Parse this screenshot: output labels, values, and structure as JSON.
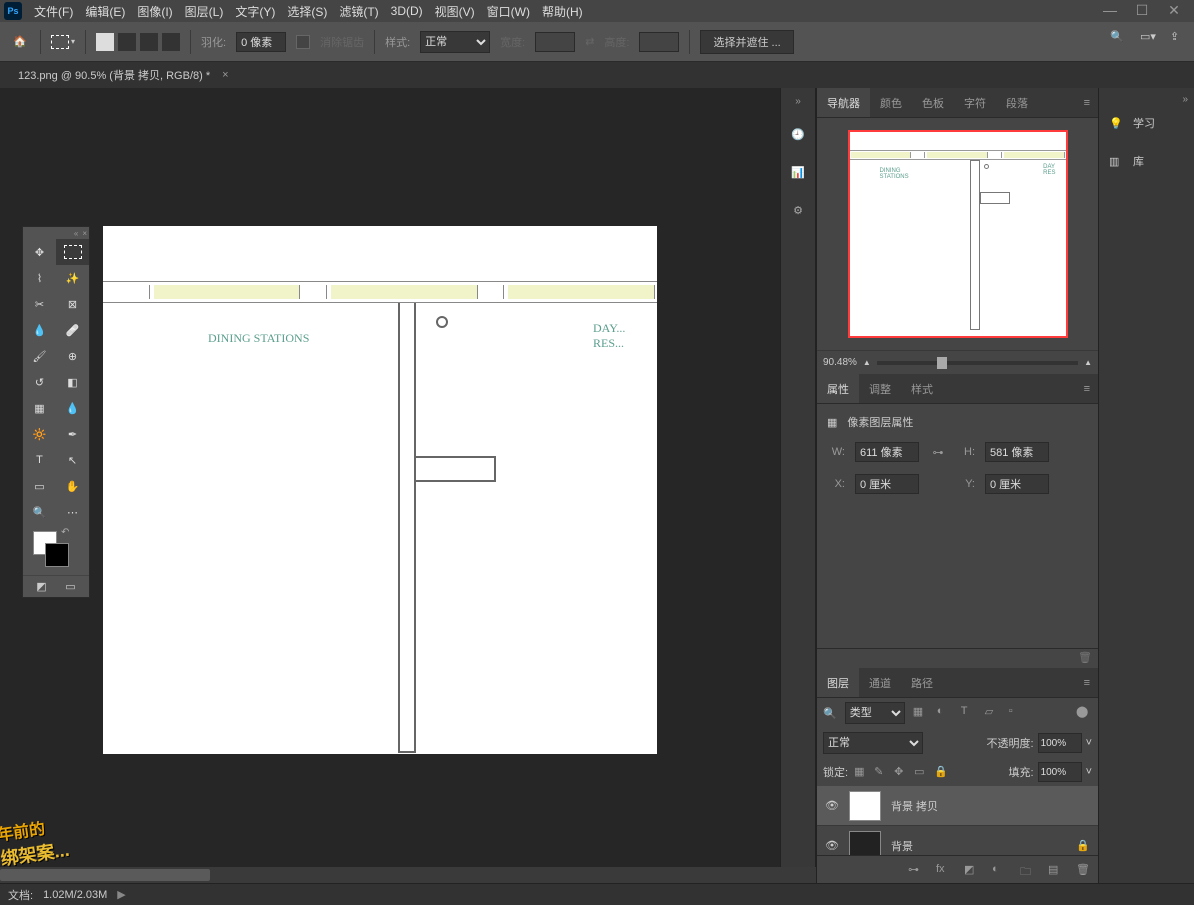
{
  "app_icon": "Ps",
  "menu": {
    "file": "文件(F)",
    "edit": "编辑(E)",
    "image": "图像(I)",
    "layer": "图层(L)",
    "type": "文字(Y)",
    "select": "选择(S)",
    "filter": "滤镜(T)",
    "threed": "3D(D)",
    "view": "视图(V)",
    "window": "窗口(W)",
    "help": "帮助(H)"
  },
  "options": {
    "feather_label": "羽化:",
    "feather_value": "0 像素",
    "antialias": "消除锯齿",
    "style_label": "样式:",
    "style_value": "正常",
    "width_label": "宽度:",
    "height_label": "高度:",
    "mask_btn": "选择并遮住 ..."
  },
  "tab": {
    "title": "123.png @ 90.5% (背景 拷贝, RGB/8) *"
  },
  "canvas": {
    "label1": "DINING\nSTATIONS",
    "label2": "DAY...\nRES..."
  },
  "nav": {
    "tabs": {
      "navigator": "导航器",
      "color": "颜色",
      "swatches": "色板",
      "char": "字符",
      "para": "段落"
    },
    "zoom": "90.48%"
  },
  "props": {
    "tabs": {
      "properties": "属性",
      "adjust": "调整",
      "styles": "样式"
    },
    "title": "像素图层属性",
    "w": "611 像素",
    "h": "581 像素",
    "x": "0 厘米",
    "y": "0 厘米",
    "wl": "W:",
    "hl": "H:",
    "xl": "X:",
    "yl": "Y:"
  },
  "layers": {
    "tabs": {
      "layers": "图层",
      "channels": "通道",
      "paths": "路径"
    },
    "filter": "类型",
    "blend": "正常",
    "opacity_label": "不透明度:",
    "opacity": "100%",
    "lock_label": "锁定:",
    "fill_label": "填充:",
    "fill": "100%",
    "items": [
      {
        "name": "背景 拷贝"
      },
      {
        "name": "背景"
      }
    ]
  },
  "right": {
    "learn": "学习",
    "lib": "库"
  },
  "status": {
    "doc_label": "文档:",
    "doc": "1.02M/2.03M"
  },
  "wm": {
    "a": "年前的",
    "b": "绑架案..."
  }
}
